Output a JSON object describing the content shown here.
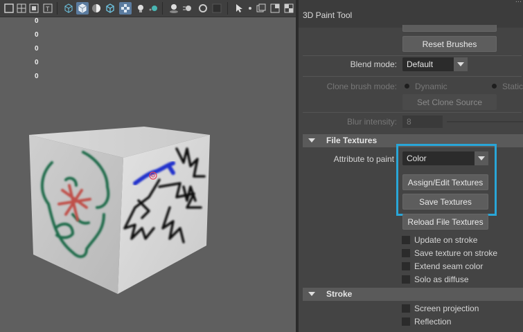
{
  "viewport": {
    "hud_values": [
      "0",
      "0",
      "0",
      "0",
      "0"
    ],
    "toolbar_icons": [
      "frame-icon",
      "grid-icon",
      "display-icon",
      "textured-icon",
      "wireframe-cube-icon",
      "shaded-cube-icon",
      "lighting-icon",
      "shaded-wire-icon",
      "xray-icon",
      "light-bulb-icon",
      "shadow-icon",
      "ambient-occlusion-icon",
      "motion-blur-icon",
      "antialias-icon",
      "depth-of-field-icon",
      "isolate-icon",
      "xray-joints-icon",
      "select-icon",
      "snapshot-icon",
      "render-view-icon",
      "camera-icon",
      "resolution-icon"
    ]
  },
  "panel": {
    "title": "3D Paint Tool",
    "title_fragment": "...",
    "reset_brushes": "Reset Brushes",
    "blend_mode": {
      "label": "Blend mode:",
      "value": "Default"
    },
    "clone_brush_mode": {
      "label": "Clone brush mode:",
      "option_dynamic": "Dynamic",
      "option_static": "Static"
    },
    "set_clone_source": "Set Clone Source",
    "blur_intensity": {
      "label": "Blur intensity:",
      "value": "8"
    },
    "file_textures_section": "File Textures",
    "attribute_to_paint": {
      "label": "Attribute to paint",
      "value": "Color"
    },
    "assign_edit_textures": "Assign/Edit Textures",
    "save_textures": "Save Textures",
    "reload_file_textures": "Reload File Textures",
    "checkboxes": {
      "update_on_stroke": "Update on stroke",
      "save_texture_on_stroke": "Save texture on stroke",
      "extend_seam_color": "Extend seam color",
      "solo_as_diffuse": "Solo as diffuse"
    },
    "stroke_section": "Stroke",
    "stroke_checkboxes": {
      "screen_projection": "Screen projection",
      "reflection": "Reflection"
    }
  },
  "colors": {
    "highlight": "#29a6d8",
    "paint_green": "#1f6b4a",
    "paint_red": "#c0504a",
    "paint_blue": "#2233cc",
    "paint_black": "#111111"
  }
}
